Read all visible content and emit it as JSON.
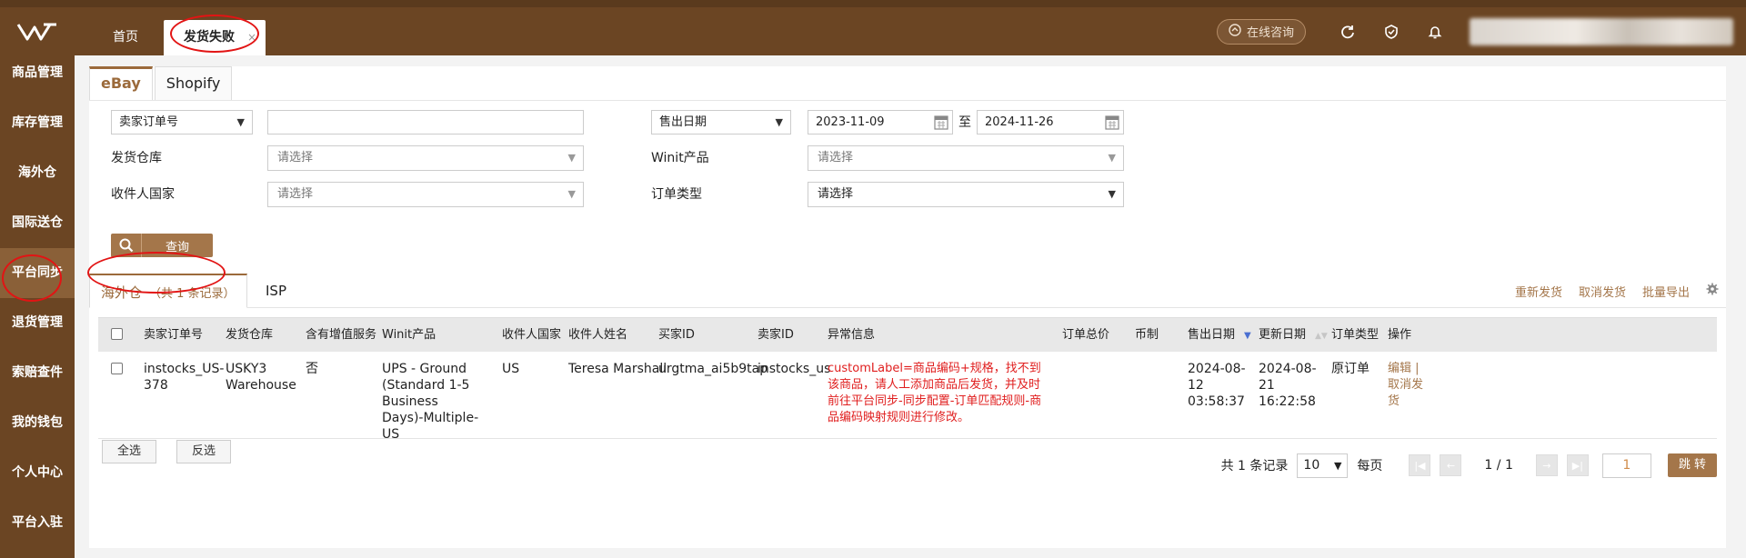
{
  "top_tabs": [
    "首页",
    "发货失败"
  ],
  "top_tab_close": "×",
  "top_right": {
    "consult_label": "在线咨询"
  },
  "sidebar": [
    "商品管理",
    "库存管理",
    "海外仓",
    "国际送仓",
    "平台同步",
    "退货管理",
    "索赔查件",
    "我的钱包",
    "个人中心",
    "平台入驻"
  ],
  "sidebar_active_index": 4,
  "platform_tabs": [
    "eBay",
    "Shopify"
  ],
  "filters": {
    "order_type_select": "卖家订单号",
    "order_no_value": "",
    "date_type_select": "售出日期",
    "date_from": "2023-11-09",
    "date_to_sep": "至",
    "date_to": "2024-11-26",
    "warehouse_label": "发货仓库",
    "warehouse_placeholder": "请选择",
    "winit_label": "Winit产品",
    "winit_placeholder": "请选择",
    "country_label": "收件人国家",
    "country_placeholder": "请选择",
    "otype_label": "订单类型",
    "otype_value": "请选择",
    "query_label": "查询"
  },
  "list_tabs": {
    "overseas": "海外仓",
    "overseas_count": "（共 1 条记录）",
    "isp": "ISP"
  },
  "actions": [
    "重新发货",
    "取消发货",
    "批量导出"
  ],
  "table": {
    "headers": [
      "卖家订单号",
      "发货仓库",
      "含有增值服务",
      "Winit产品",
      "收件人国家",
      "收件人姓名",
      "买家ID",
      "卖家ID",
      "异常信息",
      "订单总价",
      "币制",
      "售出日期",
      "更新日期",
      "订单类型",
      "操作"
    ],
    "rows": [
      {
        "seller_order": "instocks_US-378",
        "warehouse": "USKY3 Warehouse",
        "vas": "否",
        "winit_product": "UPS - Ground (Standard 1-5 Business Days)-Multiple-US",
        "country": "US",
        "name": "Teresa Marshall",
        "buyer_id": "urgtma_ai5b9tap",
        "seller_id": "instocks_us",
        "error": "customLabel=商品编码+规格，找不到该商品，请人工添加商品后发货，并及时前往平台同步-同步配置-订单匹配规则-商品编码映射规则进行修改。",
        "total": "",
        "currency": "",
        "sold_date": "2024-08-12 03:58:37",
        "update_date": "2024-08-21 16:22:58",
        "order_type": "原订单",
        "op_edit": "编辑 |",
        "op_cancel": "取消发货"
      }
    ]
  },
  "bottom": {
    "select_all": "全选",
    "invert": "反选"
  },
  "pager": {
    "total": "共 1 条记录",
    "page_size": "10",
    "per_page": "每页",
    "page_info": "1 / 1",
    "page_input": "1",
    "jump": "跳 转"
  },
  "colors": {
    "brand": "#6b4523",
    "accent": "#a4764a",
    "error": "#e01e1e"
  }
}
